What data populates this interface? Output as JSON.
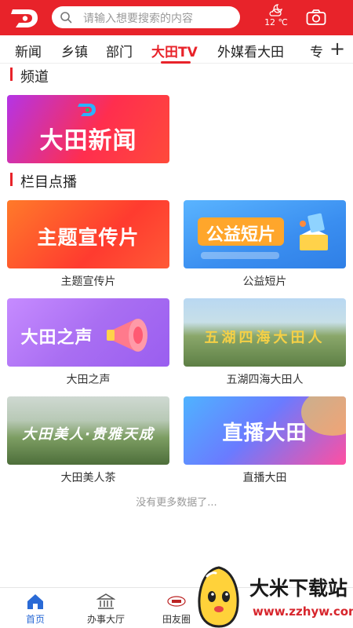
{
  "header": {
    "logo_icon": "app-logo",
    "search_placeholder": "请输入想要搜索的内容",
    "weather_temp": "12 ℃",
    "weather_icon": "cloudy-night-icon",
    "camera_icon": "camera-icon",
    "bg_color": "#e8232a"
  },
  "tabs": {
    "items": [
      "新闻",
      "乡镇",
      "部门",
      "大田TV",
      "外媒看大田",
      "专"
    ],
    "active": "大田TV",
    "more_icon": "+"
  },
  "sections": {
    "channel_title": "频道",
    "programs_title": "栏目点播"
  },
  "channel": {
    "name": "大田新闻"
  },
  "programs": [
    {
      "label": "主题宣传片",
      "thumb_text": "主题宣传片"
    },
    {
      "label": "公益短片",
      "thumb_text": "公益短片"
    },
    {
      "label": "大田之声",
      "thumb_text": "大田之声"
    },
    {
      "label": "五湖四海大田人",
      "thumb_text": "五湖四海大田人"
    },
    {
      "label": "大田美人茶",
      "thumb_text": "大田美人·贵雅天成"
    },
    {
      "label": "直播大田",
      "thumb_text": "直播大田"
    }
  ],
  "no_more_text": "没有更多数据了...",
  "bottom_nav": {
    "items": [
      {
        "label": "首页",
        "icon": "home-icon",
        "active": true
      },
      {
        "label": "办事大厅",
        "icon": "government-building-icon",
        "active": false
      },
      {
        "label": "田友圈",
        "icon": "tianyouquan-badge-icon",
        "active": false
      }
    ],
    "active_color": "#2a6ad6"
  },
  "watermark": {
    "title": "大米下载站",
    "url": "www.zzhyw.com"
  }
}
